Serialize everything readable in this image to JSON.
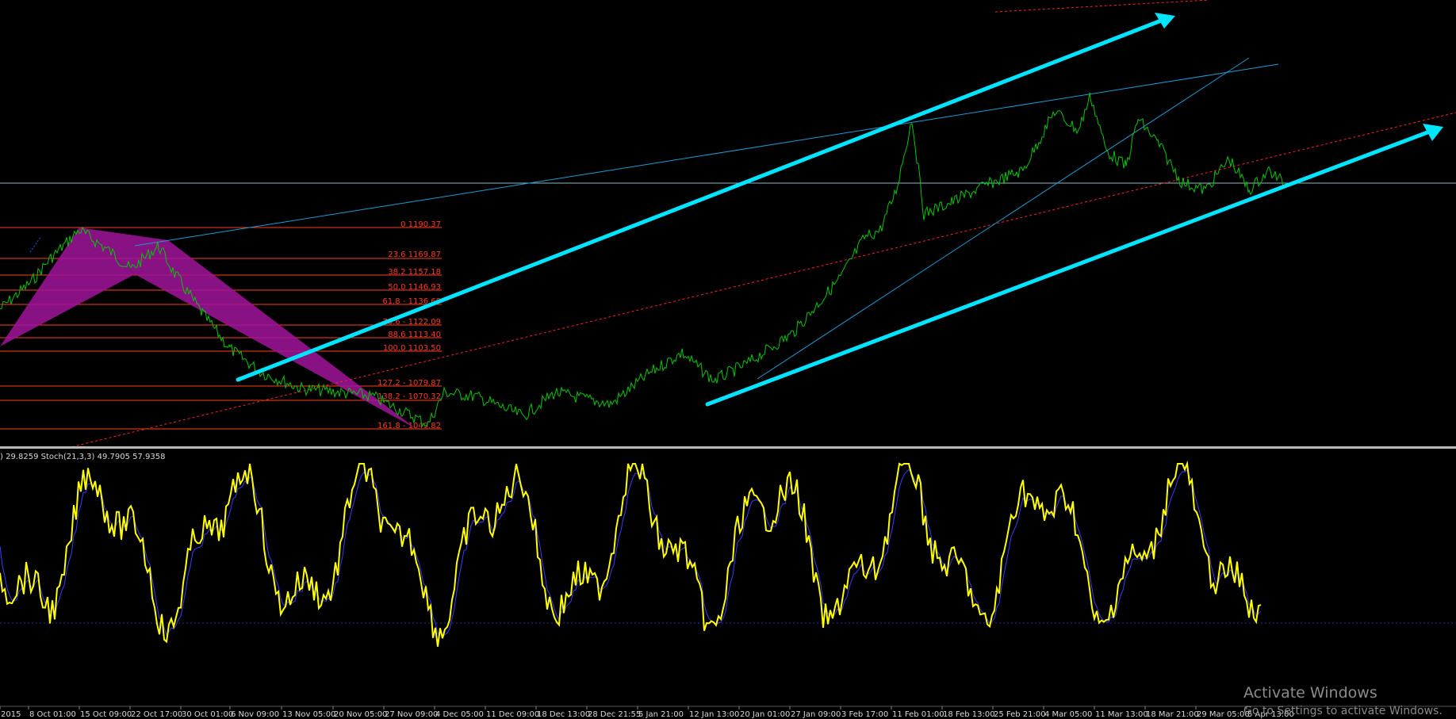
{
  "stoch_header": ") 29.8259  Stoch(21,3,3) 49.7905 57.9358",
  "fib_levels": [
    {
      "label": "0 1190.37"
    },
    {
      "label": "23.6 1169.87"
    },
    {
      "label": "38.2 1157.18"
    },
    {
      "label": "50.0 1146.93"
    },
    {
      "label": "61.8 - 1136.68"
    },
    {
      "label": "78.6 - 1122.09"
    },
    {
      "label": "88.6 1113.40"
    },
    {
      "label": "100.0 1103.50"
    },
    {
      "label": "127.2 - 1079.87"
    },
    {
      "label": "138.2 - 1070.32"
    },
    {
      "label": "161.8 - 1049.82"
    }
  ],
  "time_axis": [
    "2015",
    "8 Oct 01:00",
    "15 Oct 09:00",
    "22 Oct 17:00",
    "30 Oct 01:00",
    "6 Nov 09:00",
    "13 Nov 05:00",
    "20 Nov 05:00",
    "27 Nov 09:00",
    "4 Dec 05:00",
    "11 Dec 09:00",
    "18 Dec 13:00",
    "28 Dec 21:55",
    "5 Jan 21:00",
    "12 Jan 13:00",
    "20 Jan 01:00",
    "27 Jan 09:00",
    "3 Feb 17:00",
    "11 Feb 01:00",
    "18 Feb 13:00",
    "25 Feb 21:00",
    "4 Mar 05:00",
    "11 Mar 13:00",
    "18 Mar 21:00",
    "29 Mar 05:00",
    "5 Apr 13:00"
  ],
  "watermark": {
    "title": "Activate Windows",
    "subtitle": "Go to Settings to activate Windows."
  },
  "colors": {
    "background": "#000000",
    "price": "#00c800",
    "fib": "#ff3b1f",
    "trend_thick": "#00e5ff",
    "trend_thin": "#1e9bd7",
    "pattern": "#a0149a",
    "stoch_main": "#ffff00",
    "stoch_signal": "#3a3aff",
    "stoch_dot": "#2c2c9a"
  }
}
